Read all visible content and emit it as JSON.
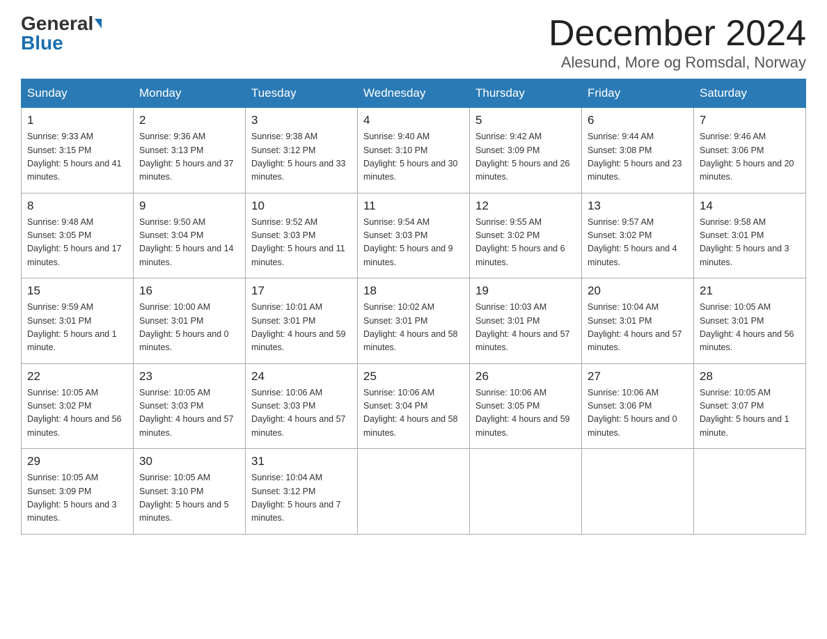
{
  "header": {
    "logo_general": "General",
    "logo_blue": "Blue",
    "month": "December 2024",
    "location": "Alesund, More og Romsdal, Norway"
  },
  "weekdays": [
    "Sunday",
    "Monday",
    "Tuesday",
    "Wednesday",
    "Thursday",
    "Friday",
    "Saturday"
  ],
  "weeks": [
    [
      {
        "day": "1",
        "sunrise": "9:33 AM",
        "sunset": "3:15 PM",
        "daylight": "5 hours and 41 minutes."
      },
      {
        "day": "2",
        "sunrise": "9:36 AM",
        "sunset": "3:13 PM",
        "daylight": "5 hours and 37 minutes."
      },
      {
        "day": "3",
        "sunrise": "9:38 AM",
        "sunset": "3:12 PM",
        "daylight": "5 hours and 33 minutes."
      },
      {
        "day": "4",
        "sunrise": "9:40 AM",
        "sunset": "3:10 PM",
        "daylight": "5 hours and 30 minutes."
      },
      {
        "day": "5",
        "sunrise": "9:42 AM",
        "sunset": "3:09 PM",
        "daylight": "5 hours and 26 minutes."
      },
      {
        "day": "6",
        "sunrise": "9:44 AM",
        "sunset": "3:08 PM",
        "daylight": "5 hours and 23 minutes."
      },
      {
        "day": "7",
        "sunrise": "9:46 AM",
        "sunset": "3:06 PM",
        "daylight": "5 hours and 20 minutes."
      }
    ],
    [
      {
        "day": "8",
        "sunrise": "9:48 AM",
        "sunset": "3:05 PM",
        "daylight": "5 hours and 17 minutes."
      },
      {
        "day": "9",
        "sunrise": "9:50 AM",
        "sunset": "3:04 PM",
        "daylight": "5 hours and 14 minutes."
      },
      {
        "day": "10",
        "sunrise": "9:52 AM",
        "sunset": "3:03 PM",
        "daylight": "5 hours and 11 minutes."
      },
      {
        "day": "11",
        "sunrise": "9:54 AM",
        "sunset": "3:03 PM",
        "daylight": "5 hours and 9 minutes."
      },
      {
        "day": "12",
        "sunrise": "9:55 AM",
        "sunset": "3:02 PM",
        "daylight": "5 hours and 6 minutes."
      },
      {
        "day": "13",
        "sunrise": "9:57 AM",
        "sunset": "3:02 PM",
        "daylight": "5 hours and 4 minutes."
      },
      {
        "day": "14",
        "sunrise": "9:58 AM",
        "sunset": "3:01 PM",
        "daylight": "5 hours and 3 minutes."
      }
    ],
    [
      {
        "day": "15",
        "sunrise": "9:59 AM",
        "sunset": "3:01 PM",
        "daylight": "5 hours and 1 minute."
      },
      {
        "day": "16",
        "sunrise": "10:00 AM",
        "sunset": "3:01 PM",
        "daylight": "5 hours and 0 minutes."
      },
      {
        "day": "17",
        "sunrise": "10:01 AM",
        "sunset": "3:01 PM",
        "daylight": "4 hours and 59 minutes."
      },
      {
        "day": "18",
        "sunrise": "10:02 AM",
        "sunset": "3:01 PM",
        "daylight": "4 hours and 58 minutes."
      },
      {
        "day": "19",
        "sunrise": "10:03 AM",
        "sunset": "3:01 PM",
        "daylight": "4 hours and 57 minutes."
      },
      {
        "day": "20",
        "sunrise": "10:04 AM",
        "sunset": "3:01 PM",
        "daylight": "4 hours and 57 minutes."
      },
      {
        "day": "21",
        "sunrise": "10:05 AM",
        "sunset": "3:01 PM",
        "daylight": "4 hours and 56 minutes."
      }
    ],
    [
      {
        "day": "22",
        "sunrise": "10:05 AM",
        "sunset": "3:02 PM",
        "daylight": "4 hours and 56 minutes."
      },
      {
        "day": "23",
        "sunrise": "10:05 AM",
        "sunset": "3:03 PM",
        "daylight": "4 hours and 57 minutes."
      },
      {
        "day": "24",
        "sunrise": "10:06 AM",
        "sunset": "3:03 PM",
        "daylight": "4 hours and 57 minutes."
      },
      {
        "day": "25",
        "sunrise": "10:06 AM",
        "sunset": "3:04 PM",
        "daylight": "4 hours and 58 minutes."
      },
      {
        "day": "26",
        "sunrise": "10:06 AM",
        "sunset": "3:05 PM",
        "daylight": "4 hours and 59 minutes."
      },
      {
        "day": "27",
        "sunrise": "10:06 AM",
        "sunset": "3:06 PM",
        "daylight": "5 hours and 0 minutes."
      },
      {
        "day": "28",
        "sunrise": "10:05 AM",
        "sunset": "3:07 PM",
        "daylight": "5 hours and 1 minute."
      }
    ],
    [
      {
        "day": "29",
        "sunrise": "10:05 AM",
        "sunset": "3:09 PM",
        "daylight": "5 hours and 3 minutes."
      },
      {
        "day": "30",
        "sunrise": "10:05 AM",
        "sunset": "3:10 PM",
        "daylight": "5 hours and 5 minutes."
      },
      {
        "day": "31",
        "sunrise": "10:04 AM",
        "sunset": "3:12 PM",
        "daylight": "5 hours and 7 minutes."
      },
      null,
      null,
      null,
      null
    ]
  ]
}
